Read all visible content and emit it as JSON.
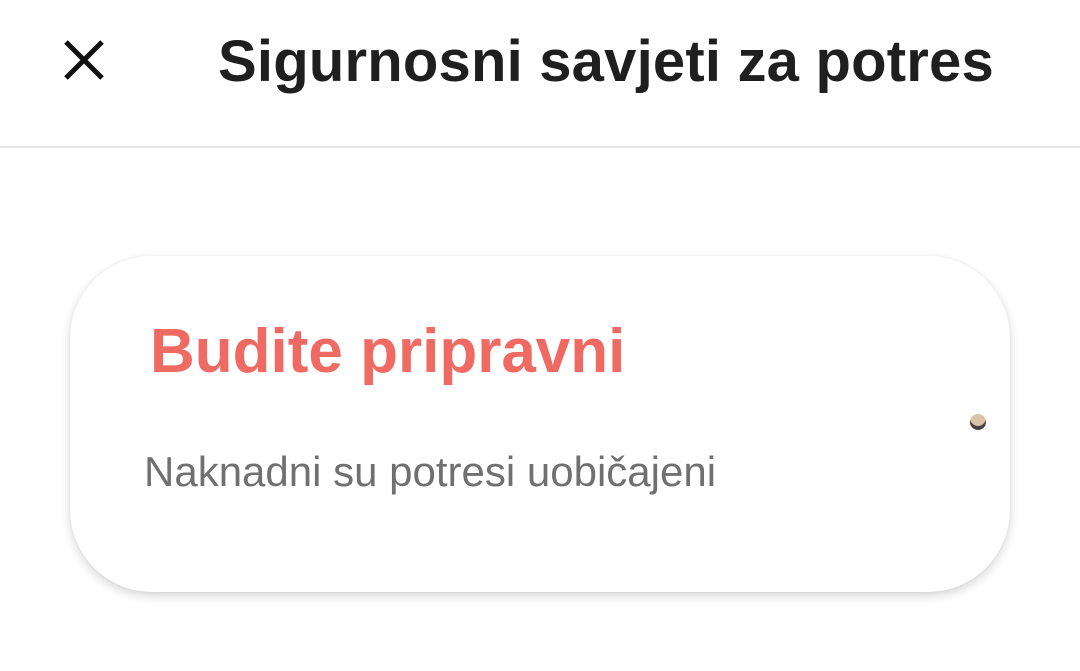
{
  "header": {
    "title": "Sigurnosni savjeti za potres",
    "close_icon": "close-icon"
  },
  "card": {
    "title": "Budite pripravni",
    "subtitle": "Naknadni su potresi uobičajeni"
  },
  "colors": {
    "accent": "#ef6a62",
    "title_text": "#1f1f1f",
    "subtitle_text": "#707070"
  }
}
